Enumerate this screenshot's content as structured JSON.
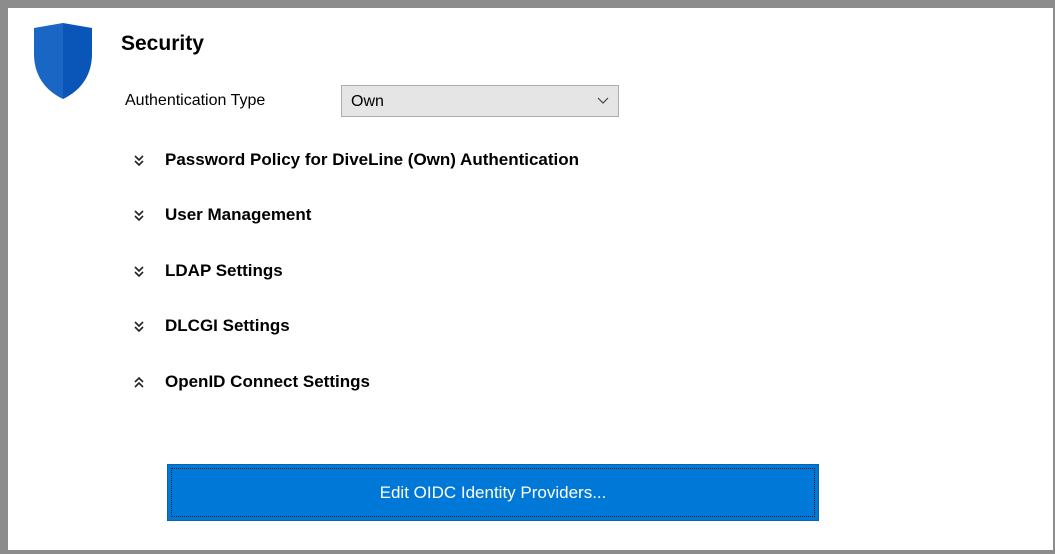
{
  "header": {
    "title": "Security",
    "icon": "shield-icon",
    "icon_color": "#1f6fce"
  },
  "authentication": {
    "label": "Authentication Type",
    "selected": "Own"
  },
  "sections": [
    {
      "label": "Password Policy for DiveLine (Own) Authentication",
      "expanded": false
    },
    {
      "label": "User Management",
      "expanded": false
    },
    {
      "label": "LDAP Settings",
      "expanded": false
    },
    {
      "label": "DLCGI Settings",
      "expanded": false
    },
    {
      "label": "OpenID Connect Settings",
      "expanded": true
    }
  ],
  "oidc": {
    "button_label": "Edit OIDC Identity Providers...",
    "button_color": "#0078d7"
  }
}
